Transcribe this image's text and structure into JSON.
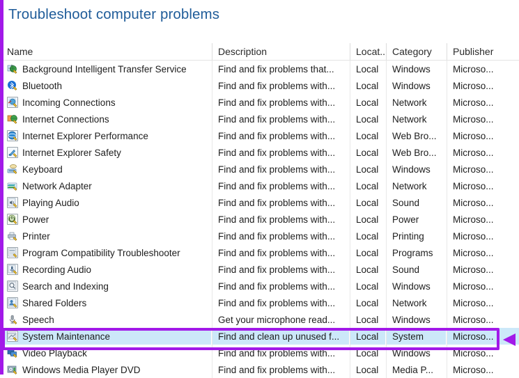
{
  "page_title": "Troubleshoot computer problems",
  "colors": {
    "title": "#1f5c99",
    "annotation": "#a219e8",
    "selection": "#cce8f9"
  },
  "columns": {
    "name": "Name",
    "description": "Description",
    "location": "Locat...",
    "category": "Category",
    "publisher": "Publisher"
  },
  "rows": [
    {
      "icon": "bits-icon",
      "name": "Background Intelligent Transfer Service",
      "description": "Find and fix problems that...",
      "location": "Local",
      "category": "Windows",
      "publisher": "Microso...",
      "selected": false
    },
    {
      "icon": "bluetooth-icon",
      "name": "Bluetooth",
      "description": "Find and fix problems with...",
      "location": "Local",
      "category": "Windows",
      "publisher": "Microso...",
      "selected": false
    },
    {
      "icon": "incoming-connections-icon",
      "name": "Incoming Connections",
      "description": "Find and fix problems with...",
      "location": "Local",
      "category": "Network",
      "publisher": "Microso...",
      "selected": false
    },
    {
      "icon": "internet-connections-icon",
      "name": "Internet Connections",
      "description": "Find and fix problems with...",
      "location": "Local",
      "category": "Network",
      "publisher": "Microso...",
      "selected": false
    },
    {
      "icon": "ie-performance-icon",
      "name": "Internet Explorer Performance",
      "description": "Find and fix problems with...",
      "location": "Local",
      "category": "Web Bro...",
      "publisher": "Microso...",
      "selected": false
    },
    {
      "icon": "ie-safety-icon",
      "name": "Internet Explorer Safety",
      "description": "Find and fix problems with...",
      "location": "Local",
      "category": "Web Bro...",
      "publisher": "Microso...",
      "selected": false
    },
    {
      "icon": "keyboard-icon",
      "name": "Keyboard",
      "description": "Find and fix problems with...",
      "location": "Local",
      "category": "Windows",
      "publisher": "Microso...",
      "selected": false
    },
    {
      "icon": "network-adapter-icon",
      "name": "Network Adapter",
      "description": "Find and fix problems with...",
      "location": "Local",
      "category": "Network",
      "publisher": "Microso...",
      "selected": false
    },
    {
      "icon": "playing-audio-icon",
      "name": "Playing Audio",
      "description": "Find and fix problems with...",
      "location": "Local",
      "category": "Sound",
      "publisher": "Microso...",
      "selected": false
    },
    {
      "icon": "power-icon",
      "name": "Power",
      "description": "Find and fix problems with...",
      "location": "Local",
      "category": "Power",
      "publisher": "Microso...",
      "selected": false
    },
    {
      "icon": "printer-icon",
      "name": "Printer",
      "description": "Find and fix problems with...",
      "location": "Local",
      "category": "Printing",
      "publisher": "Microso...",
      "selected": false
    },
    {
      "icon": "program-compatibility-icon",
      "name": "Program Compatibility Troubleshooter",
      "description": "Find and fix problems with...",
      "location": "Local",
      "category": "Programs",
      "publisher": "Microso...",
      "selected": false
    },
    {
      "icon": "recording-audio-icon",
      "name": "Recording Audio",
      "description": "Find and fix problems with...",
      "location": "Local",
      "category": "Sound",
      "publisher": "Microso...",
      "selected": false
    },
    {
      "icon": "search-indexing-icon",
      "name": "Search and Indexing",
      "description": "Find and fix problems with...",
      "location": "Local",
      "category": "Windows",
      "publisher": "Microso...",
      "selected": false
    },
    {
      "icon": "shared-folders-icon",
      "name": "Shared Folders",
      "description": "Find and fix problems with...",
      "location": "Local",
      "category": "Network",
      "publisher": "Microso...",
      "selected": false
    },
    {
      "icon": "speech-icon",
      "name": "Speech",
      "description": "Get your microphone read...",
      "location": "Local",
      "category": "Windows",
      "publisher": "Microso...",
      "selected": false
    },
    {
      "icon": "system-maintenance-icon",
      "name": "System Maintenance",
      "description": "Find and clean up unused f...",
      "location": "Local",
      "category": "System",
      "publisher": "Microso...",
      "selected": true
    },
    {
      "icon": "video-playback-icon",
      "name": "Video Playback",
      "description": "Find and fix problems with...",
      "location": "Local",
      "category": "Windows",
      "publisher": "Microso...",
      "selected": false
    },
    {
      "icon": "wmp-dvd-icon",
      "name": "Windows Media Player DVD",
      "description": "Find and fix problems with...",
      "location": "Local",
      "category": "Media P...",
      "publisher": "Microso...",
      "selected": false
    }
  ]
}
